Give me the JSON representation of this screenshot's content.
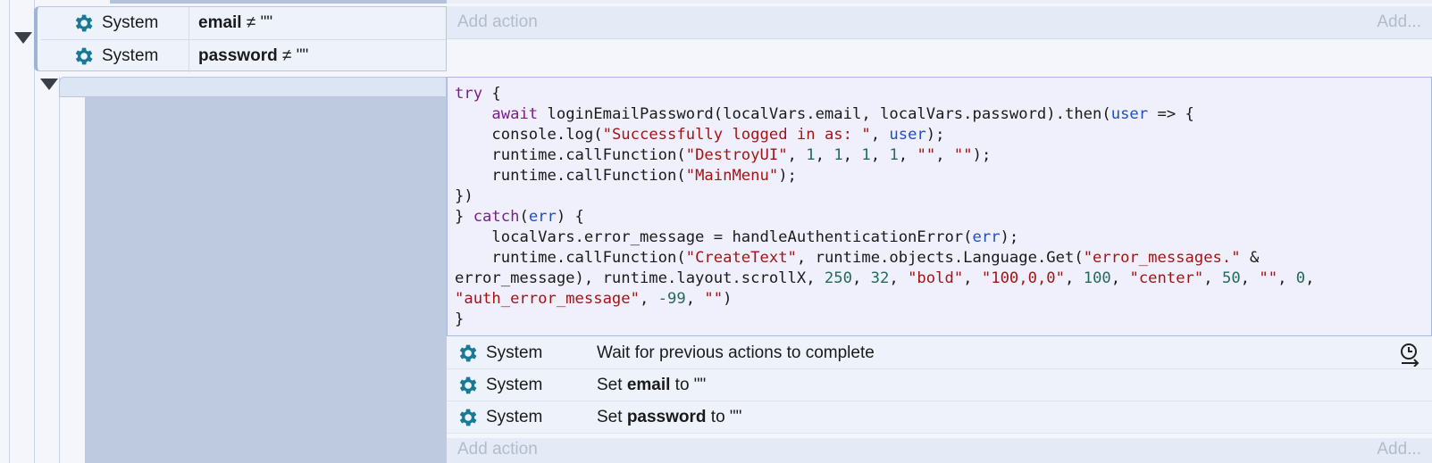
{
  "event": {
    "conditions": [
      {
        "object": "System",
        "var": "email",
        "op": "≠",
        "value": "\"\""
      },
      {
        "object": "System",
        "var": "password",
        "op": "≠",
        "value": "\"\""
      }
    ],
    "add_action_label": "Add action",
    "add_label": "Add..."
  },
  "sub_event": {
    "script": {
      "line1_try": "try",
      "line1_brace": " {",
      "line2_await": "await",
      "line2_call": " loginEmailPassword(localVars.email, localVars.password).then(",
      "line2_user": "user",
      "line2_arrow": " => {",
      "line3_log": "console.log(",
      "line3_str": "\"Successfully logged in as: \"",
      "line3_comma": ", ",
      "line3_user": "user",
      "line3_end": ");",
      "line4_call": "runtime.callFunction(",
      "line4_str": "\"DestroyUI\"",
      "line4_sep": ", ",
      "line4_n1": "1",
      "line4_n2": "1",
      "line4_n3": "1",
      "line4_n4": "1",
      "line4_e1": "\"\"",
      "line4_e2": "\"\"",
      "line4_end": ");",
      "line5_call": "runtime.callFunction(",
      "line5_str": "\"MainMenu\"",
      "line5_end": ");",
      "line6": "})",
      "line7_brace": "} ",
      "line7_catch": "catch",
      "line7_open": "(",
      "line7_err": "err",
      "line7_close": ") {",
      "line8_a": "localVars.error_message = handleAuthenticationError(",
      "line8_err": "err",
      "line8_end": ");",
      "line9_call": "runtime.callFunction(",
      "line9_str1": "\"CreateText\"",
      "line9_mid": ", runtime.objects.Language.Get(",
      "line9_str2": "\"error_messages.\"",
      "line9_end": " &",
      "line10_a": "error_message), runtime.layout.scrollX, ",
      "line10_n250": "250",
      "line10_n32": "32",
      "line10_bold": "\"bold\"",
      "line10_rgb": "\"100,0,0\"",
      "line10_n100": "100",
      "line10_center": "\"center\"",
      "line10_n50": "50",
      "line10_empty": "\"\"",
      "line10_n0": "0",
      "line10_tail": ",",
      "line11_str": "\"auth_error_message\"",
      "line11_n99": "-99",
      "line11_empty": "\"\"",
      "line11_end": ")",
      "line12": "}"
    },
    "actions": [
      {
        "object": "System",
        "text": "Wait for previous actions to complete"
      },
      {
        "object": "System",
        "prefix": "Set ",
        "bold": "email",
        "suffix": " to \"\""
      },
      {
        "object": "System",
        "prefix": "Set ",
        "bold": "password",
        "suffix": " to \"\""
      }
    ],
    "add_action_label": "Add action",
    "add_label": "Add..."
  },
  "colors": {
    "gear": "#1a7a96",
    "script_bg": "#f0f0fc",
    "event_bg": "#eef3fb"
  }
}
